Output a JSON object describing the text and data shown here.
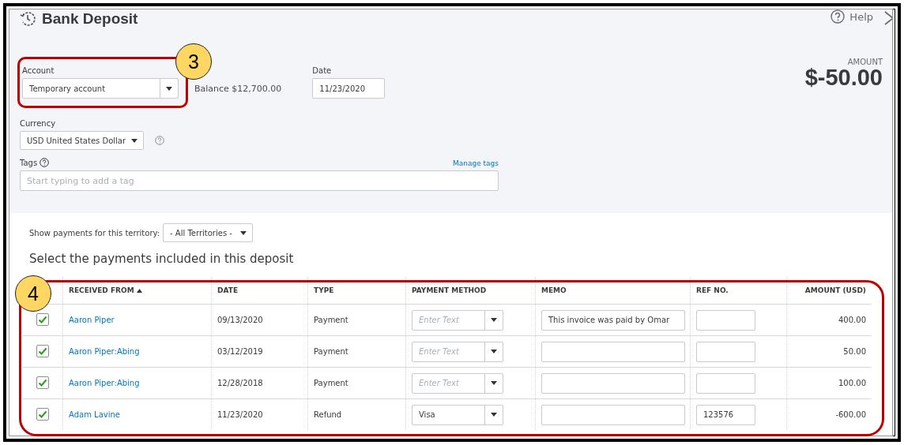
{
  "window": {
    "title": "Bank Deposit",
    "help": "Help"
  },
  "account": {
    "label": "Account",
    "value": "Temporary account",
    "balance": "Balance $12,700.00"
  },
  "date": {
    "label": "Date",
    "value": "11/23/2020"
  },
  "amount": {
    "label": "AMOUNT",
    "value": "$-50.00"
  },
  "currency": {
    "label": "Currency",
    "value": "USD United States Dollar"
  },
  "tags": {
    "label": "Tags",
    "placeholder": "Start typing to add a tag",
    "link": "Manage tags"
  },
  "territory": {
    "label": "Show payments for this territory:",
    "value": "- All Territories -"
  },
  "section_title": "Select the payments included in this deposit",
  "callouts": [
    {
      "label": "3"
    },
    {
      "label": "4"
    }
  ],
  "table": {
    "columns": [
      {
        "label": "RECEIVED FROM",
        "sorted": true
      },
      {
        "label": "DATE",
        "sorted": false
      },
      {
        "label": "TYPE",
        "sorted": false
      },
      {
        "label": "PAYMENT METHOD",
        "sorted": false
      },
      {
        "label": "MEMO",
        "sorted": false
      },
      {
        "label": "REF NO.",
        "sorted": false
      },
      {
        "label": "AMOUNT (USD)",
        "sorted": false
      }
    ],
    "rows": [
      {
        "checked": true,
        "received_from": "Aaron Piper",
        "date": "09/13/2020",
        "type": "Payment",
        "payment_method": {
          "placeholder": "Enter Text"
        },
        "memo": "This invoice was paid by Omar",
        "amount": "400.00"
      },
      {
        "checked": true,
        "received_from": "Aaron Piper:Abing",
        "date": "03/12/2019",
        "type": "Payment",
        "payment_method": {
          "placeholder": "Enter Text"
        },
        "amount": "50.00"
      },
      {
        "checked": true,
        "received_from": "Aaron Piper:Abing",
        "date": "12/28/2018",
        "type": "Payment",
        "payment_method": {
          "placeholder": "Enter Text"
        },
        "amount": "100.00"
      },
      {
        "checked": true,
        "received_from": "Adam Lavine",
        "date": "11/23/2020",
        "type": "Refund",
        "payment_method": {
          "value": "Visa"
        },
        "ref_no": "123576",
        "amount": "-600.00"
      }
    ]
  }
}
